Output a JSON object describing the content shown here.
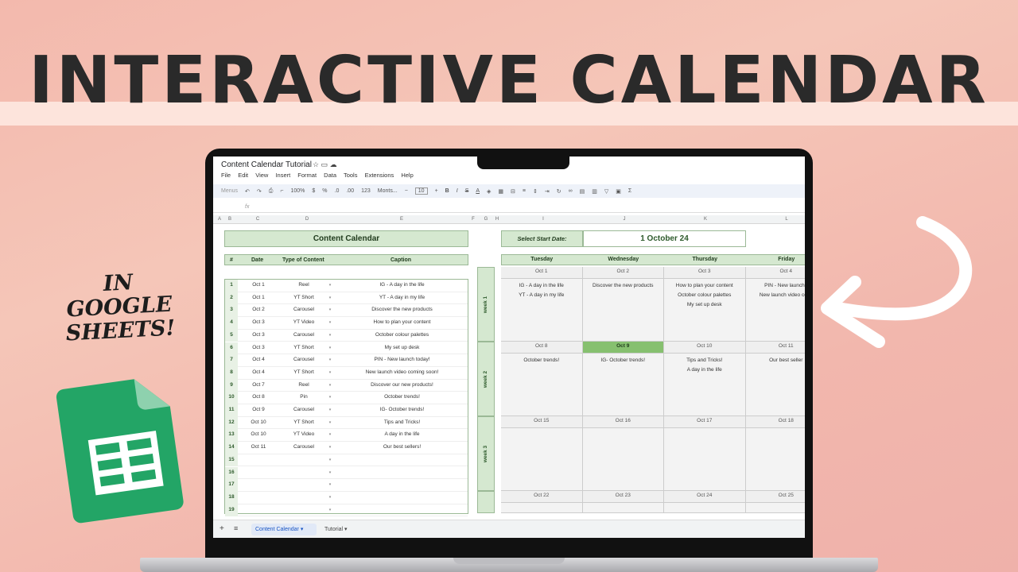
{
  "headline": "INTERACTIVE CALENDAR",
  "side_text": [
    "IN",
    "GOOGLE",
    "SHEETS!"
  ],
  "colors": {
    "green": "#d5e8d0",
    "green_border": "#9bb996",
    "highlight": "#86c06f",
    "sheets_green": "#23a566"
  },
  "doc": {
    "title": "Content Calendar Tutorial",
    "menu": [
      "File",
      "Edit",
      "View",
      "Insert",
      "Format",
      "Data",
      "Tools",
      "Extensions",
      "Help"
    ],
    "toolbar": {
      "menus": "Menus",
      "zoom": "100%",
      "currency": "$",
      "percent": "%",
      "decimals": ".0",
      "decimals_more": ".00",
      "number_format": "123",
      "font": "Monts...",
      "font_size": "10"
    },
    "fx": "fx"
  },
  "columns": [
    "A",
    "B",
    "C",
    "D",
    "E",
    "F",
    "G",
    "H",
    "I",
    "J",
    "K",
    "L"
  ],
  "left_table": {
    "title": "Content Calendar",
    "headers": [
      "#",
      "Date",
      "Type of Content",
      "Caption"
    ],
    "rows": [
      {
        "num": "1",
        "date": "Oct 1",
        "type": "Reel",
        "caption": "IG - A day in the life"
      },
      {
        "num": "2",
        "date": "Oct 1",
        "type": "YT Short",
        "caption": "YT - A day in my life"
      },
      {
        "num": "3",
        "date": "Oct 2",
        "type": "Carousel",
        "caption": "Discover the new products"
      },
      {
        "num": "4",
        "date": "Oct 3",
        "type": "YT Video",
        "caption": "How to plan your content"
      },
      {
        "num": "5",
        "date": "Oct 3",
        "type": "Carousel",
        "caption": "October colour palettes"
      },
      {
        "num": "6",
        "date": "Oct 3",
        "type": "YT Short",
        "caption": "My set up desk"
      },
      {
        "num": "7",
        "date": "Oct 4",
        "type": "Carousel",
        "caption": "PIN - New launch today!"
      },
      {
        "num": "8",
        "date": "Oct 4",
        "type": "YT Short",
        "caption": "New launch video coming soon!"
      },
      {
        "num": "9",
        "date": "Oct 7",
        "type": "Reel",
        "caption": "Discover our new products!"
      },
      {
        "num": "10",
        "date": "Oct 8",
        "type": "Pin",
        "caption": "October trends!"
      },
      {
        "num": "11",
        "date": "Oct 9",
        "type": "Carousel",
        "caption": "IG- October trends!"
      },
      {
        "num": "12",
        "date": "Oct 10",
        "type": "YT Short",
        "caption": "Tips and Tricks!"
      },
      {
        "num": "13",
        "date": "Oct 10",
        "type": "YT Video",
        "caption": "A day in the life"
      },
      {
        "num": "14",
        "date": "Oct 11",
        "type": "Carousel",
        "caption": "Our best sellers!"
      },
      {
        "num": "15",
        "date": "",
        "type": "",
        "caption": ""
      },
      {
        "num": "16",
        "date": "",
        "type": "",
        "caption": ""
      },
      {
        "num": "17",
        "date": "",
        "type": "",
        "caption": ""
      },
      {
        "num": "18",
        "date": "",
        "type": "",
        "caption": ""
      },
      {
        "num": "19",
        "date": "",
        "type": "",
        "caption": ""
      }
    ]
  },
  "calendar": {
    "start_label": "Select Start Date:",
    "start_value": "1 October 24",
    "days": [
      "Tuesday",
      "Wednesday",
      "Thursday",
      "Friday"
    ],
    "weeks": [
      {
        "label": "week 1",
        "dates": [
          "Oct 1",
          "Oct 2",
          "Oct 3",
          "Oct 4"
        ],
        "items": [
          [
            "IG - A day in the life",
            "YT - A day in my life"
          ],
          [
            "Discover the new products"
          ],
          [
            "How to plan your content",
            "October colour palettes",
            "My set up desk"
          ],
          [
            "PIN - New launch t",
            "New launch video comi"
          ]
        ]
      },
      {
        "label": "week 2",
        "dates": [
          "Oct 8",
          "Oct 9",
          "Oct 10",
          "Oct 11"
        ],
        "items": [
          [
            "October trends!"
          ],
          [
            "IG- October trends!"
          ],
          [
            "Tips and Tricks!",
            "A day in the life"
          ],
          [
            "Our best seller"
          ]
        ]
      },
      {
        "label": "week 3",
        "dates": [
          "Oct 15",
          "Oct 16",
          "Oct 17",
          "Oct 18"
        ],
        "items": [
          [],
          [],
          [],
          []
        ]
      },
      {
        "label": "",
        "dates": [
          "Oct 22",
          "Oct 23",
          "Oct 24",
          "Oct 25"
        ],
        "items": [
          [],
          [],
          [],
          []
        ]
      }
    ]
  },
  "tabs": [
    "Content Calendar",
    "Tutorial"
  ]
}
